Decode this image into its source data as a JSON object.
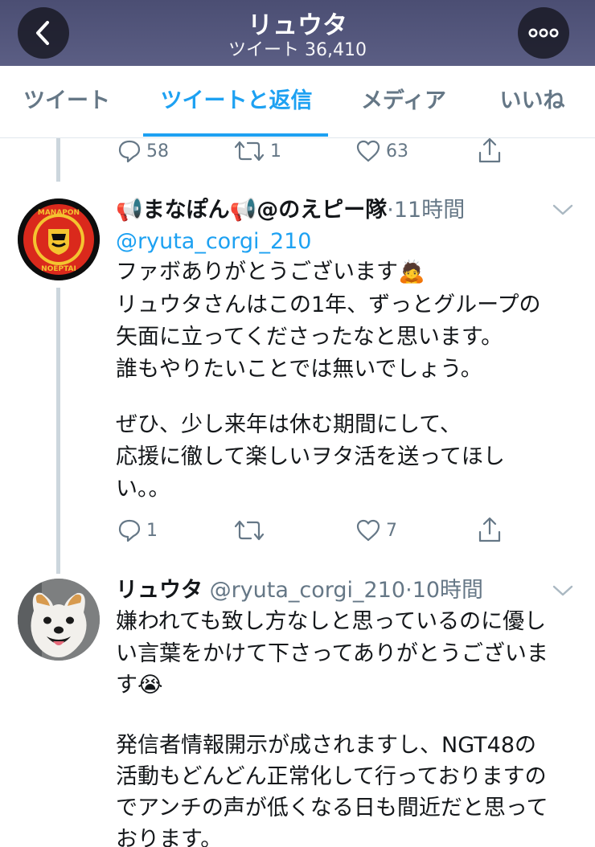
{
  "header": {
    "title": "リュウタ",
    "subtitle": "ツイート 36,410"
  },
  "tabs": [
    {
      "label": "ツイート"
    },
    {
      "label": "ツイートと返信"
    },
    {
      "label": "メディア"
    },
    {
      "label": "いいね"
    }
  ],
  "tweet0": {
    "replies": "58",
    "retweets": "1",
    "likes": "63"
  },
  "tweet1": {
    "display_name": "まなぽん",
    "display_name_2": "@のえピー隊",
    "time": "11時間",
    "mention": "@ryuta_corgi_210",
    "lines": [
      "ファボありがとうございます",
      "リュウタさんはこの1年、ずっとグループの",
      "矢面に立ってくださったなと思います。",
      "誰もやりたいことでは無いでしょう。",
      "ぜひ、少し来年は休む期間にして、",
      "応援に徹して楽しいヲタ活を送ってほし",
      "い。。"
    ],
    "avatar_text_top": "MANAPON",
    "avatar_text_bottom": "NOEPTAI",
    "replies": "1",
    "retweets": "",
    "likes": "7"
  },
  "tweet2": {
    "display_name": "リュウタ",
    "handle": "@ryuta_corgi_210",
    "time": "10時間",
    "lines": [
      "嫌われても致し方なしと思っているのに優し",
      "い言葉をかけて下さってありがとうございま",
      "す",
      "発信者情報開示が成されますし、NGT48の",
      "活動もどんどん正常化して行っておりますの",
      "でアンチの声が低くなる日も間近だと思って",
      "おります。"
    ]
  },
  "colors": {
    "accent": "#1da1f2",
    "muted": "#657786",
    "header_bg": "#4b4e73"
  },
  "icons": [
    "back-icon",
    "more-icon",
    "reply-icon",
    "retweet-icon",
    "like-icon",
    "share-icon",
    "megaphone-icon",
    "chevron-down-icon",
    "bowing-emoji",
    "crying-emoji"
  ]
}
